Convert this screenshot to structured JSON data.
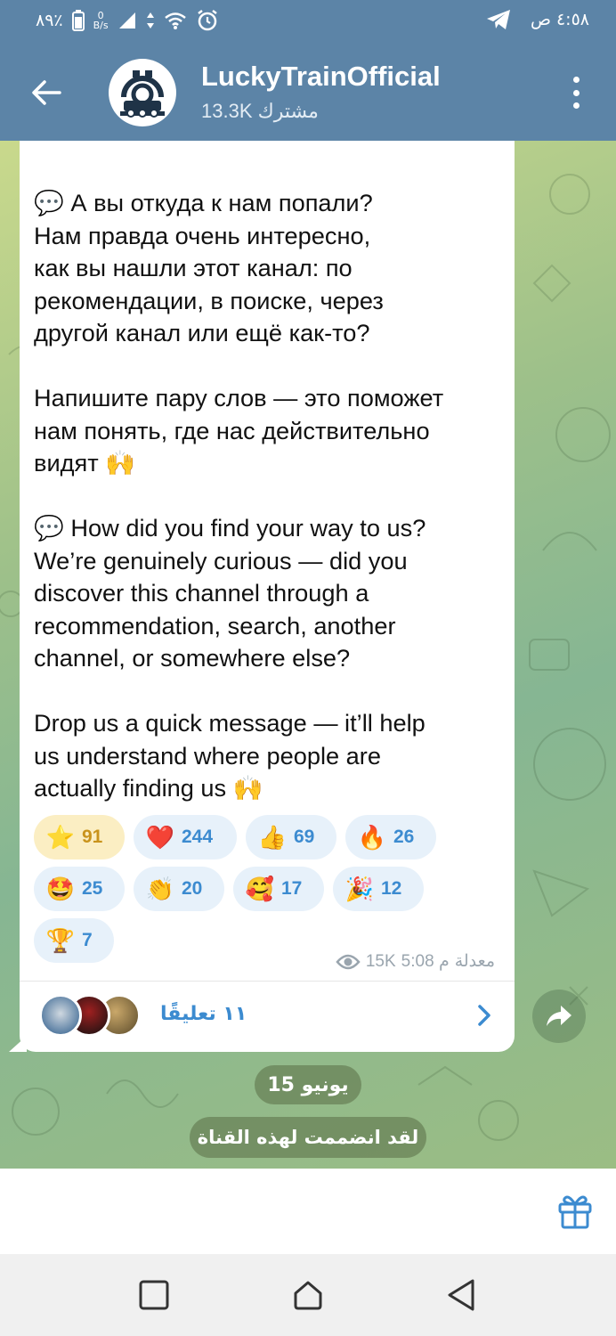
{
  "status_bar": {
    "battery": "٨٩٪",
    "data_rate": "0",
    "data_unit": "B/s",
    "time": "٤:٥٨",
    "am_pm": "ص"
  },
  "header": {
    "title": "LuckyTrainOfficial",
    "subscribers": "13.3K مشترك"
  },
  "message": {
    "text": "💬 А вы откуда к нам попали?\nНам правда очень интересно,\nкак вы нашли этот канал: по\nрекомендации, в поиске, через\nдругой канал или ещё как-то?\n\nНапишите пару слов — это поможет\nнам понять, где нас действительно\nвидят 🙌\n\n💬 How did you find your way to us?\nWe’re genuinely curious — did you\ndiscover this channel through a\nrecommendation, search, another\nchannel, or somewhere else?\n\nDrop us a quick message — it’ll help\nus understand where people are\nactually finding us 🙌",
    "edited_label": "معدلة",
    "time": "5:08 م",
    "views": "15K"
  },
  "reactions": [
    {
      "emoji": "⭐",
      "count": "91"
    },
    {
      "emoji": "❤️",
      "count": "244"
    },
    {
      "emoji": "👍",
      "count": "69"
    },
    {
      "emoji": "🔥",
      "count": "26"
    },
    {
      "emoji": "🤩",
      "count": "25"
    },
    {
      "emoji": "👏",
      "count": "20"
    },
    {
      "emoji": "🥰",
      "count": "17"
    },
    {
      "emoji": "🎉",
      "count": "12"
    },
    {
      "emoji": "🏆",
      "count": "7"
    }
  ],
  "comments": {
    "label": "١١ تعليقًا"
  },
  "date_separator": "15 يونيو",
  "service_message": "لقد انضممت لهذه القناة",
  "colors": {
    "header": "#5c84a7",
    "accent": "#3c8bd0",
    "star_reaction_bg": "#fbeec3"
  }
}
